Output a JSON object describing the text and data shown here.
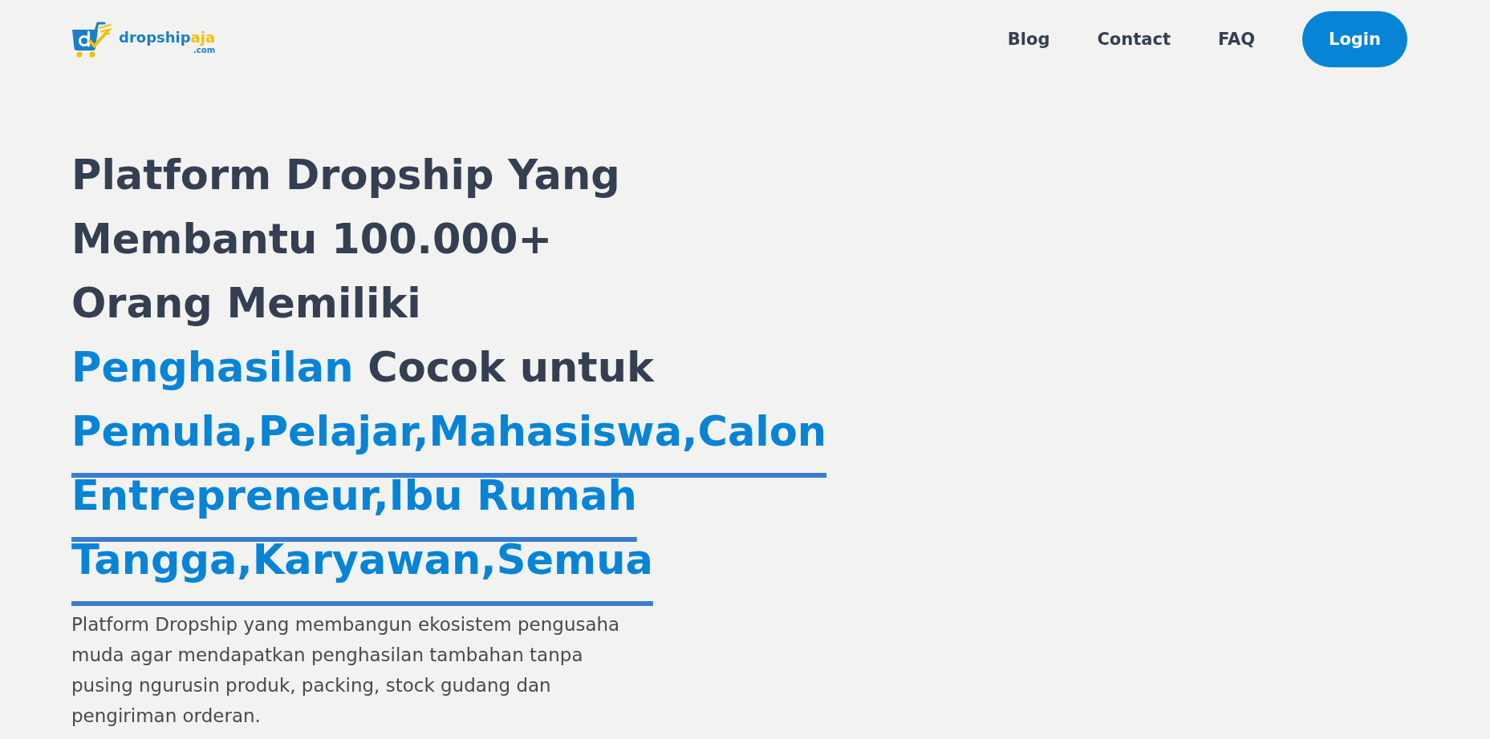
{
  "header": {
    "logo": {
      "wordmark": "dropship",
      "wordmark_accent": "aja",
      "domain": ".com"
    },
    "nav_links": [
      "Blog",
      "Contact",
      "FAQ"
    ],
    "login_button": "Login"
  },
  "hero": {
    "headline_lines": [
      {
        "text": "Platform Dropship Yang"
      },
      {
        "text": "Membantu 100.000+"
      },
      {
        "text": "Orang Memiliki"
      },
      {
        "accent": "Penghasilan",
        "text": "Cocok untuk"
      }
    ],
    "typed_text": "Pemula,Pelajar,Mahasiswa,Calon Entrepreneur,Ibu Rumah Tangga,Karyawan,Semua",
    "description": "Platform Dropship yang membangun ekosistem pengusaha muda agar mendapatkan penghasilan tambahan tanpa pusing ngurusin produk, packing, stock gudang dan pengiriman orderan."
  }
}
